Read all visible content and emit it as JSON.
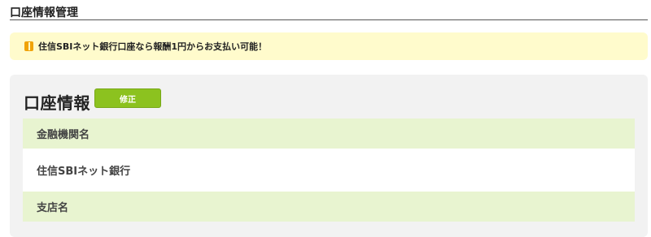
{
  "page": {
    "title": "口座情報管理"
  },
  "notice": {
    "text": "住信SBIネット銀行口座なら報酬1円からお支払い可能！",
    "icon": "alert-icon",
    "color": "#f0a30a"
  },
  "account": {
    "title": "口座情報",
    "edit_label": "修正",
    "fields": [
      {
        "label": "金融機関名",
        "value": "住信SBIネット銀行"
      },
      {
        "label": "支店名"
      }
    ]
  },
  "colors": {
    "accent": "#8cc21f",
    "label_bg": "#e8f4d0",
    "notice_bg": "#fffbcc",
    "card_bg": "#f2f2f2"
  }
}
